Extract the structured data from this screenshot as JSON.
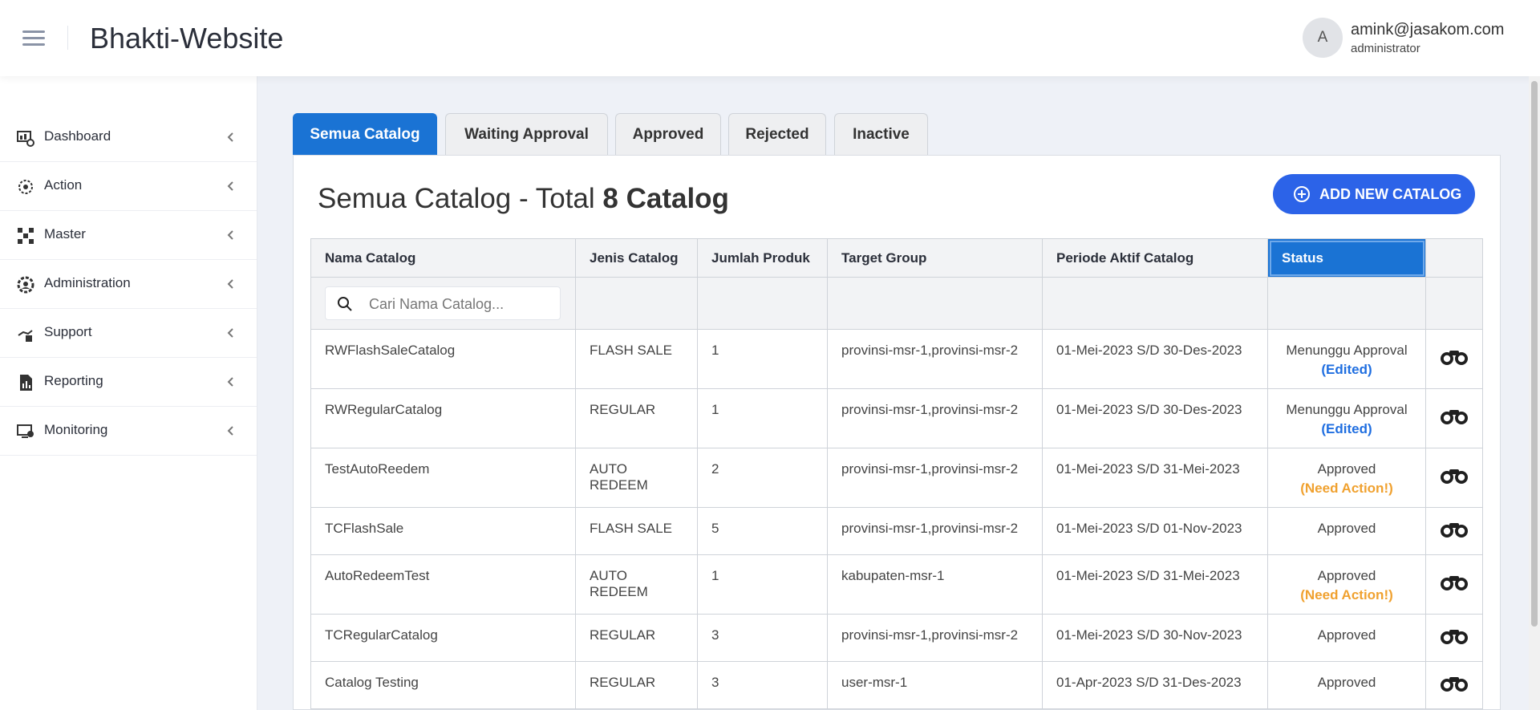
{
  "app": {
    "title": "Bhakti-Website"
  },
  "user": {
    "avatar_initial": "A",
    "email": "amink@jasakom.com",
    "role": "administrator"
  },
  "sidebar": {
    "items": [
      {
        "label": "Dashboard",
        "icon": "dashboard-icon"
      },
      {
        "label": "Action",
        "icon": "action-icon"
      },
      {
        "label": "Master",
        "icon": "master-icon"
      },
      {
        "label": "Administration",
        "icon": "administration-icon"
      },
      {
        "label": "Support",
        "icon": "support-icon"
      },
      {
        "label": "Reporting",
        "icon": "reporting-icon"
      },
      {
        "label": "Monitoring",
        "icon": "monitoring-icon"
      }
    ]
  },
  "tabs": [
    {
      "label": "Semua Catalog",
      "active": true
    },
    {
      "label": "Waiting Approval",
      "active": false
    },
    {
      "label": "Approved",
      "active": false
    },
    {
      "label": "Rejected",
      "active": false
    },
    {
      "label": "Inactive",
      "active": false
    }
  ],
  "main": {
    "title_prefix": "Semua Catalog - Total ",
    "title_bold": "8 Catalog",
    "add_button": "ADD NEW CATALOG"
  },
  "search": {
    "placeholder": "Cari Nama Catalog..."
  },
  "table": {
    "headers": [
      "Nama Catalog",
      "Jenis Catalog",
      "Jumlah Produk",
      "Target Group",
      "Periode Aktif Catalog",
      "Status"
    ],
    "rows": [
      {
        "nama": "RWFlashSaleCatalog",
        "jenis": "FLASH SALE",
        "jumlah": "1",
        "target": "provinsi-msr-1,provinsi-msr-2",
        "periode": "01-Mei-2023 S/D 30-Des-2023",
        "status": "Menunggu Approval",
        "note": "(Edited)",
        "note_type": "edited"
      },
      {
        "nama": "RWRegularCatalog",
        "jenis": "REGULAR",
        "jumlah": "1",
        "target": "provinsi-msr-1,provinsi-msr-2",
        "periode": "01-Mei-2023 S/D 30-Des-2023",
        "status": "Menunggu Approval",
        "note": "(Edited)",
        "note_type": "edited"
      },
      {
        "nama": "TestAutoReedem",
        "jenis": "AUTO REDEEM",
        "jumlah": "2",
        "target": "provinsi-msr-1,provinsi-msr-2",
        "periode": "01-Mei-2023 S/D 31-Mei-2023",
        "status": "Approved",
        "note": "(Need Action!)",
        "note_type": "action"
      },
      {
        "nama": "TCFlashSale",
        "jenis": "FLASH SALE",
        "jumlah": "5",
        "target": "provinsi-msr-1,provinsi-msr-2",
        "periode": "01-Mei-2023 S/D 01-Nov-2023",
        "status": "Approved",
        "note": "",
        "note_type": ""
      },
      {
        "nama": "AutoRedeemTest",
        "jenis": "AUTO REDEEM",
        "jumlah": "1",
        "target": "kabupaten-msr-1",
        "periode": "01-Mei-2023 S/D 31-Mei-2023",
        "status": "Approved",
        "note": "(Need Action!)",
        "note_type": "action"
      },
      {
        "nama": "TCRegularCatalog",
        "jenis": "REGULAR",
        "jumlah": "3",
        "target": "provinsi-msr-1,provinsi-msr-2",
        "periode": "01-Mei-2023 S/D 30-Nov-2023",
        "status": "Approved",
        "note": "",
        "note_type": ""
      },
      {
        "nama": "Catalog Testing",
        "jenis": "REGULAR",
        "jumlah": "3",
        "target": "user-msr-1",
        "periode": "01-Apr-2023 S/D 31-Des-2023",
        "status": "Approved",
        "note": "",
        "note_type": ""
      }
    ]
  },
  "colors": {
    "primary": "#1a73d4",
    "button": "#2c63e8",
    "edited": "#1f6ee0",
    "need_action": "#f0a12f"
  }
}
